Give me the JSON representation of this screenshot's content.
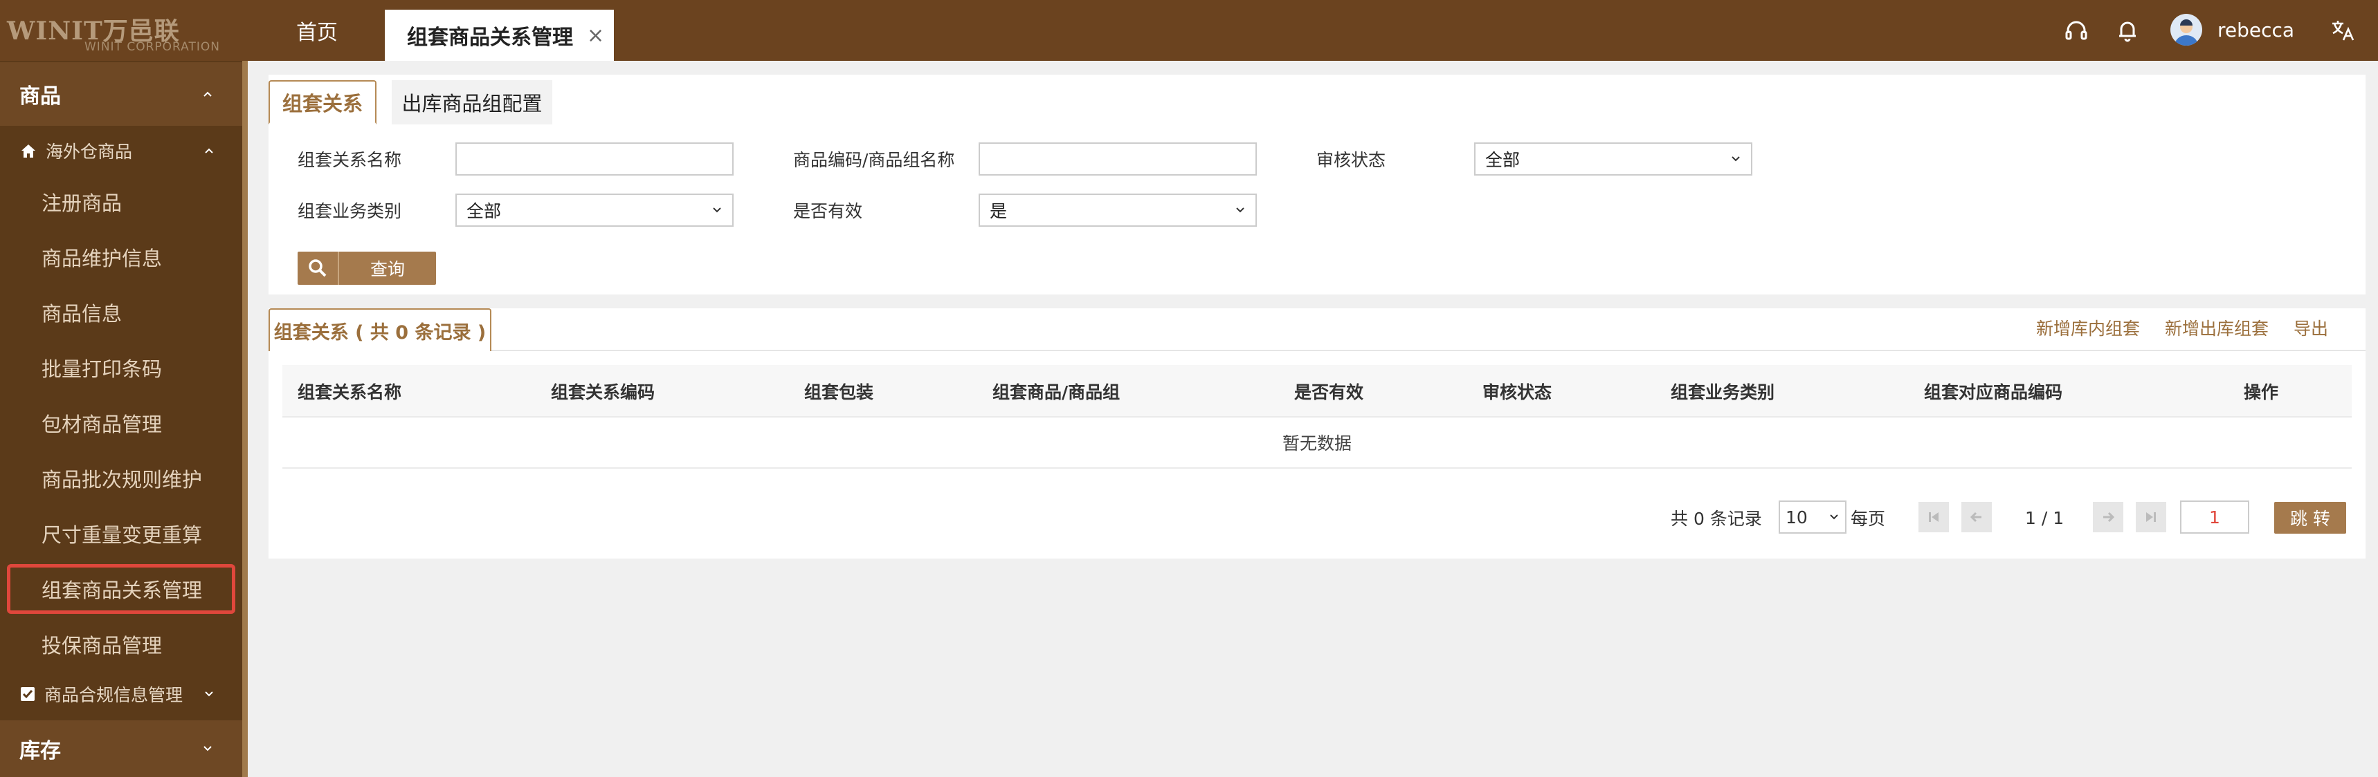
{
  "brand": {
    "logo_text": "WINIT万邑联",
    "logo_sub": "WINIT CORPORATION"
  },
  "header": {
    "tabs": [
      {
        "label": "首页"
      },
      {
        "label": "组套商品关系管理",
        "close": "×"
      }
    ],
    "user_name": "rebecca",
    "icons": [
      "headset-icon",
      "bell-icon",
      "avatar",
      "translate-icon"
    ]
  },
  "sidebar": {
    "group_goods": "商品",
    "sub_overseas": "海外仓商品",
    "items": [
      {
        "label": "注册商品"
      },
      {
        "label": "商品维护信息"
      },
      {
        "label": "商品信息"
      },
      {
        "label": "批量打印条码"
      },
      {
        "label": "包材商品管理"
      },
      {
        "label": "商品批次规则维护"
      },
      {
        "label": "尺寸重量变更重算"
      },
      {
        "label": "组套商品关系管理"
      },
      {
        "label": "投保商品管理"
      }
    ],
    "sub_compliance": "商品合规信息管理",
    "group_inventory": "库存"
  },
  "subtabs": {
    "active": "组套关系",
    "other": "出库商品组配置"
  },
  "filters": {
    "name_label": "组套关系名称",
    "name_value": "",
    "code_label": "商品编码/商品组名称",
    "code_value": "",
    "audit_label": "审核状态",
    "audit_value": "全部",
    "biz_label": "组套业务类别",
    "biz_value": "全部",
    "valid_label": "是否有效",
    "valid_value": "是",
    "query_label": "查询"
  },
  "list": {
    "title": "组套关系 ( 共 0 条记录 )",
    "actions": [
      "新增库内组套",
      "新增出库组套",
      "导出"
    ],
    "columns": [
      "组套关系名称",
      "组套关系编码",
      "组套包装",
      "组套商品/商品组",
      "是否有效",
      "审核状态",
      "组套业务类别",
      "组套对应商品编码",
      "操作"
    ],
    "empty_text": "暂无数据"
  },
  "pager": {
    "total_text": "共 0 条记录",
    "page_size": "10",
    "per_page": "每页",
    "page_info": "1 / 1",
    "jump_value": "1",
    "jump_label": "跳 转"
  },
  "colors": {
    "header_bg": "#6b431f",
    "sidebar_bg": "#5b3a19",
    "accent": "#a57a4d",
    "highlight_border": "#e0473c"
  }
}
